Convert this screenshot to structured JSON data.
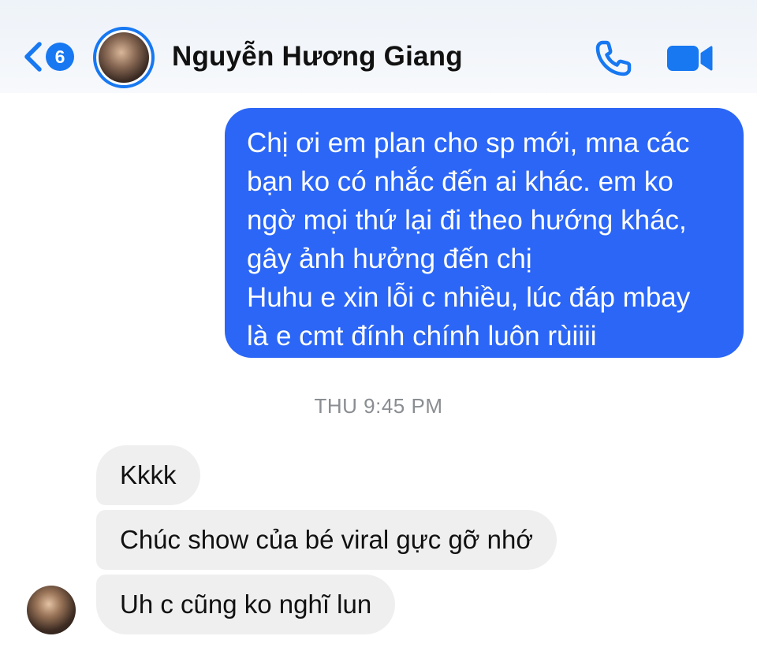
{
  "header": {
    "unread_count": "6",
    "contact_name": "Nguyễn Hương Giang",
    "icons": {
      "back": "chevron-left-icon",
      "call": "phone-icon",
      "video": "video-camera-icon"
    },
    "accent_color": "#1778f2"
  },
  "conversation": {
    "outgoing_message": {
      "lines": [
        "Chị ơi em plan cho sp mới, mna các",
        "bạn ko có nhắc đến ai khác. em ko",
        "ngờ mọi thứ lại đi theo hướng khác,",
        "gây ảnh hưởng đến chị",
        "Huhu e xin lỗi c nhiều, lúc đáp mbay",
        "là e cmt đính chính luôn rùiiii"
      ],
      "bubble_color": "#2b66f6"
    },
    "timestamp": "THU 9:45 PM",
    "incoming_messages": [
      "Kkkk",
      "Chúc show của bé viral gực gỡ nhớ",
      "Uh c cũng ko nghĩ lun"
    ]
  }
}
